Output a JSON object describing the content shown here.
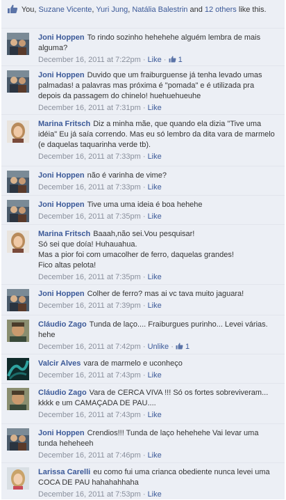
{
  "likes_summary": {
    "prefix": "You, ",
    "names": [
      "Suzane Vicente",
      "Yuri Jung",
      "Natália Balestrin"
    ],
    "sep1": ", ",
    "sep2": ", ",
    "and": " and ",
    "others": "12 others",
    "suffix": " like this."
  },
  "colors": {
    "link": "#3b5998",
    "meta": "#898f9c",
    "background": "#eceff5"
  },
  "comments": [
    {
      "author": "Joni Hoppen",
      "text": "To rindo sozinho hehehehe alguém lembra de mais alguma?",
      "time": "December 16, 2011 at 7:22pm",
      "action": "Like",
      "like_count": "1",
      "avatar_icon": "avatar-joni"
    },
    {
      "author": "Joni Hoppen",
      "text": "Duvido que um fraiburguense já tenha levado umas palmadas! a palavras mas próxima é \"pomada\" e é utilizada pra depois da passagem do chinelo! huehuehueuhe",
      "time": "December 16, 2011 at 7:31pm",
      "action": "Like",
      "avatar_icon": "avatar-joni"
    },
    {
      "author": "Marina Fritsch",
      "text": "Diz a minha mãe, que quando ela dizia \"Tive uma idéia\" Eu já saía correndo. Mas eu só lembro da dita vara de marmelo (e daquelas taquarinha verde tb).",
      "time": "December 16, 2011 at 7:33pm",
      "action": "Like",
      "avatar_icon": "avatar-marina"
    },
    {
      "author": "Joni Hoppen",
      "text": "não é varinha de vime?",
      "time": "December 16, 2011 at 7:33pm",
      "action": "Like",
      "avatar_icon": "avatar-joni"
    },
    {
      "author": "Joni Hoppen",
      "text": "Tive uma uma ideia é boa hehehe",
      "time": "December 16, 2011 at 7:35pm",
      "action": "Like",
      "avatar_icon": "avatar-joni"
    },
    {
      "author": "Marina Fritsch",
      "text": "Baaah,não sei.Vou pesquisar!",
      "extra_lines": [
        "Só sei que doía! Huhauahua.",
        "Mas a pior foi com umacolher de ferro, daquelas grandes!",
        "Fico altas pelota!"
      ],
      "time": "December 16, 2011 at 7:35pm",
      "action": "Like",
      "avatar_icon": "avatar-marina"
    },
    {
      "author": "Joni Hoppen",
      "text": "Colher de ferro? mas ai vc tava muito jaguara!",
      "time": "December 16, 2011 at 7:39pm",
      "action": "Like",
      "avatar_icon": "avatar-joni"
    },
    {
      "author": "Cláudio Zago",
      "text": "Tunda de laço.... Fraiburgues purinho... Levei várias. hehe",
      "time": "December 16, 2011 at 7:42pm",
      "action": "Unlike",
      "like_count": "1",
      "avatar_icon": "avatar-claudio"
    },
    {
      "author": "Valcir Alves",
      "text": "vara de marmelo e uconheço",
      "time": "December 16, 2011 at 7:43pm",
      "action": "Like",
      "avatar_icon": "avatar-valcir"
    },
    {
      "author": "Cláudio Zago",
      "text": "Vara de CERCA VIVA !!! Só os fortes sobreviveram... kkkk e um CAMAÇADA DE PAU....",
      "time": "December 16, 2011 at 7:43pm",
      "action": "Like",
      "avatar_icon": "avatar-claudio"
    },
    {
      "author": "Joni Hoppen",
      "text": "Crendios!!! Tunda de laço hehehehe Vai levar uma tunda heheheeh",
      "time": "December 16, 2011 at 7:46pm",
      "action": "Like",
      "avatar_icon": "avatar-joni"
    },
    {
      "author": "Larissa Carelli",
      "text": "eu como fui uma crianca obediente nunca levei uma COCA DE PAU hahahahhaha",
      "time": "December 16, 2011 at 7:53pm",
      "action": "Like",
      "avatar_icon": "avatar-larissa"
    }
  ]
}
